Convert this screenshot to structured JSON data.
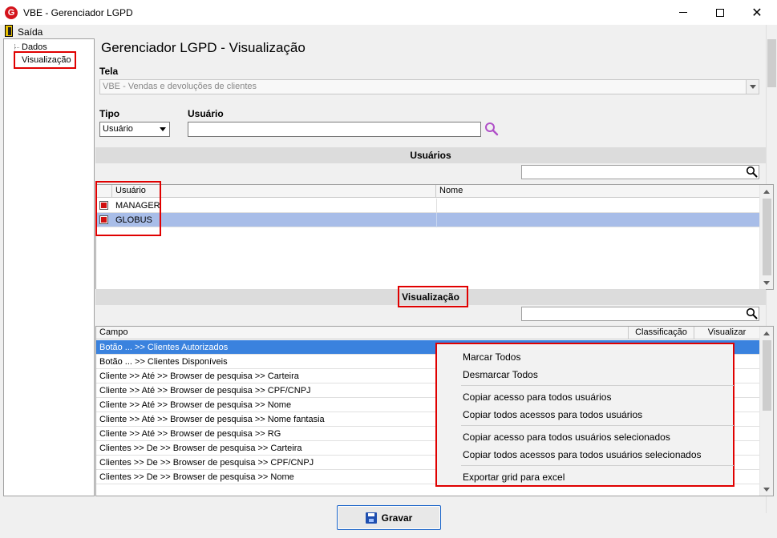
{
  "window": {
    "title": "VBE - Gerenciador LGPD"
  },
  "menu": {
    "exit_label": "Saída"
  },
  "tree": {
    "items": [
      "Dados",
      "Visualização"
    ]
  },
  "page": {
    "title": "Gerenciador LGPD - Visualização"
  },
  "tela": {
    "label": "Tela",
    "value": "VBE - Vendas e devoluções de clientes"
  },
  "tipo": {
    "label": "Tipo",
    "value": "Usuário"
  },
  "usuario": {
    "label": "Usuário",
    "value": ""
  },
  "usuarios_section": {
    "title": "Usuários",
    "columns": [
      "Usuário",
      "Nome"
    ],
    "rows": [
      {
        "usuario": "MANAGER",
        "nome": "",
        "checked": true
      },
      {
        "usuario": "GLOBUS",
        "nome": "",
        "checked": true
      }
    ]
  },
  "visualizacao_section": {
    "title": "Visualização",
    "columns": [
      "Campo",
      "Classificação",
      "Visualizar"
    ],
    "rows": [
      "Botão ... >> Clientes Autorizados",
      "Botão ... >> Clientes Disponíveis",
      "Cliente >> Até >> Browser de pesquisa >> Carteira",
      "Cliente >> Até >> Browser de pesquisa >> CPF/CNPJ",
      "Cliente >> Até >> Browser de pesquisa >> Nome",
      "Cliente >> Até >> Browser de pesquisa >> Nome fantasia",
      "Cliente >> Até >> Browser de pesquisa >> RG",
      "Clientes >> De >> Browser de pesquisa >> Carteira",
      "Clientes >> De >> Browser de pesquisa >> CPF/CNPJ",
      "Clientes >> De >> Browser de pesquisa >> Nome"
    ]
  },
  "context_menu": {
    "items": [
      "Marcar Todos",
      "Desmarcar Todos",
      "Copiar acesso para todos usuários",
      "Copiar todos acessos para todos usuários",
      "Copiar acesso para todos usuários selecionados",
      "Copiar todos acessos para todos usuários selecionados",
      "Exportar grid para excel"
    ]
  },
  "footer": {
    "save_label": "Gravar"
  },
  "colors": {
    "highlight": "#e00000",
    "selected_row": "#a8bde8",
    "active_row": "#3a82de",
    "search_icon": "#b050c8"
  }
}
